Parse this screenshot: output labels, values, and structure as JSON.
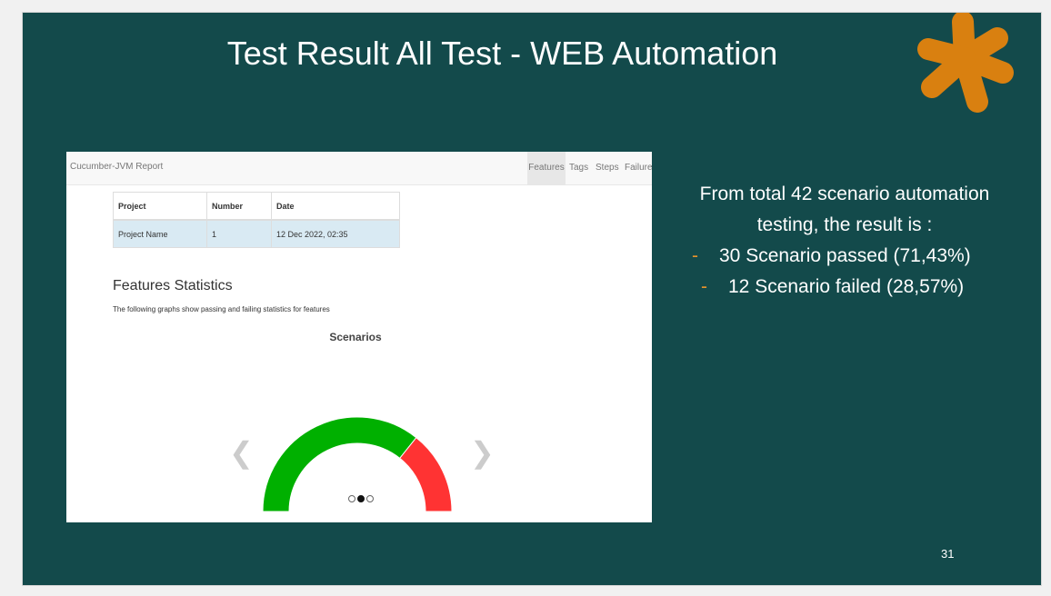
{
  "slide": {
    "title": "Test Result All Test - WEB Automation",
    "page_number": "31",
    "accent_color": "#d98010",
    "background_color": "#134a4b"
  },
  "report": {
    "brand": "Cucumber-JVM Report",
    "tabs": [
      {
        "label": "Features",
        "active": true
      },
      {
        "label": "Tags",
        "active": false
      },
      {
        "label": "Steps",
        "active": false
      },
      {
        "label": "Failures",
        "active": false
      }
    ],
    "table": {
      "headers": [
        "Project",
        "Number",
        "Date"
      ],
      "rows": [
        [
          "Project Name",
          "1",
          "12 Dec 2022, 02:35"
        ]
      ]
    },
    "section_title": "Features Statistics",
    "section_desc": "The following graphs show passing and failing statistics for features",
    "chart_title": "Scenarios",
    "prev_icon": "chevron-left-icon",
    "next_icon": "chevron-right-icon",
    "carousel": {
      "count": 3,
      "active": 1
    }
  },
  "chart_data": {
    "type": "pie",
    "title": "Scenarios",
    "categories": [
      "passed",
      "failed"
    ],
    "values": [
      30,
      12
    ],
    "colors": [
      "#00b000",
      "#ff3333"
    ]
  },
  "summary": {
    "intro": "From total 42 scenario automation testing, the result is :",
    "bullets": [
      "30 Scenario passed (71,43%)",
      "12 Scenario failed (28,57%)"
    ],
    "bullet_marker": "-"
  }
}
